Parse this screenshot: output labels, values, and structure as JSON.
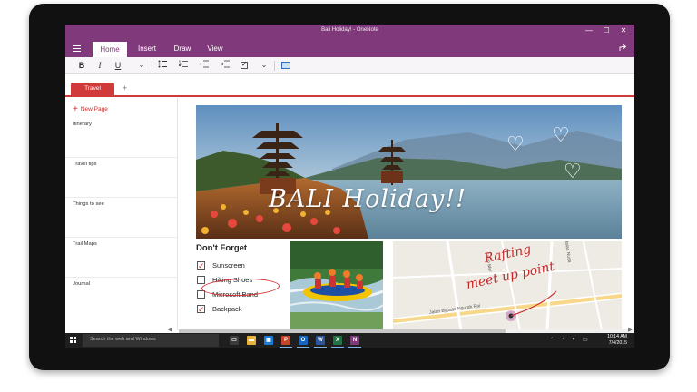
{
  "window": {
    "title": "Bali Holiday! - OneNote",
    "minimize": "—",
    "maximize": "☐",
    "close": "✕"
  },
  "ribbon": {
    "tabs": [
      "Home",
      "Insert",
      "Draw",
      "View"
    ],
    "active_tab": "Home",
    "share_icon": "share-icon"
  },
  "toolbar": {
    "bold": "B",
    "italic": "I",
    "underline": "U",
    "more": "⌄",
    "checkbox": "✓"
  },
  "sections": {
    "active": "Travel",
    "add": "+"
  },
  "pages": {
    "new_page": "New Page",
    "items": [
      "Itinerary",
      "Travel tips",
      "Things to see",
      "Trail Maps",
      "Journal"
    ]
  },
  "note": {
    "hero_text": "BALI Holiday!!",
    "todo_title": "Don't Forget",
    "todo_items": [
      {
        "label": "Sunscreen",
        "checked": true
      },
      {
        "label": "Hiking Shoes",
        "checked": false
      },
      {
        "label": "Microsoft Band",
        "checked": false
      },
      {
        "label": "Backpack",
        "checked": true
      }
    ],
    "map_note_line1": "Rafting",
    "map_note_line2": "meet up point",
    "road_label_1": "Jalan Bypass Ngurah Rai",
    "road_label_2": "Jalan Nusa",
    "road_label_3": "Jalan Mer"
  },
  "taskbar": {
    "search_placeholder": "Search the web and Windows",
    "time": "10:14 AM",
    "date": "7/4/2015",
    "apps": [
      {
        "icon": "task-view-icon",
        "glyph": "▭",
        "color": "#3b3b3b"
      },
      {
        "icon": "file-explorer-icon",
        "glyph": "▬",
        "color": "#e8b33a"
      },
      {
        "icon": "store-icon",
        "glyph": "▣",
        "color": "#1f7ad1"
      },
      {
        "icon": "powerpoint-icon",
        "glyph": "P",
        "color": "#c5452b"
      },
      {
        "icon": "outlook-icon",
        "glyph": "O",
        "color": "#1565c0"
      },
      {
        "icon": "word-icon",
        "glyph": "W",
        "color": "#2b579a"
      },
      {
        "icon": "excel-icon",
        "glyph": "X",
        "color": "#217346"
      },
      {
        "icon": "onenote-icon",
        "glyph": "N",
        "color": "#80397b"
      }
    ]
  }
}
